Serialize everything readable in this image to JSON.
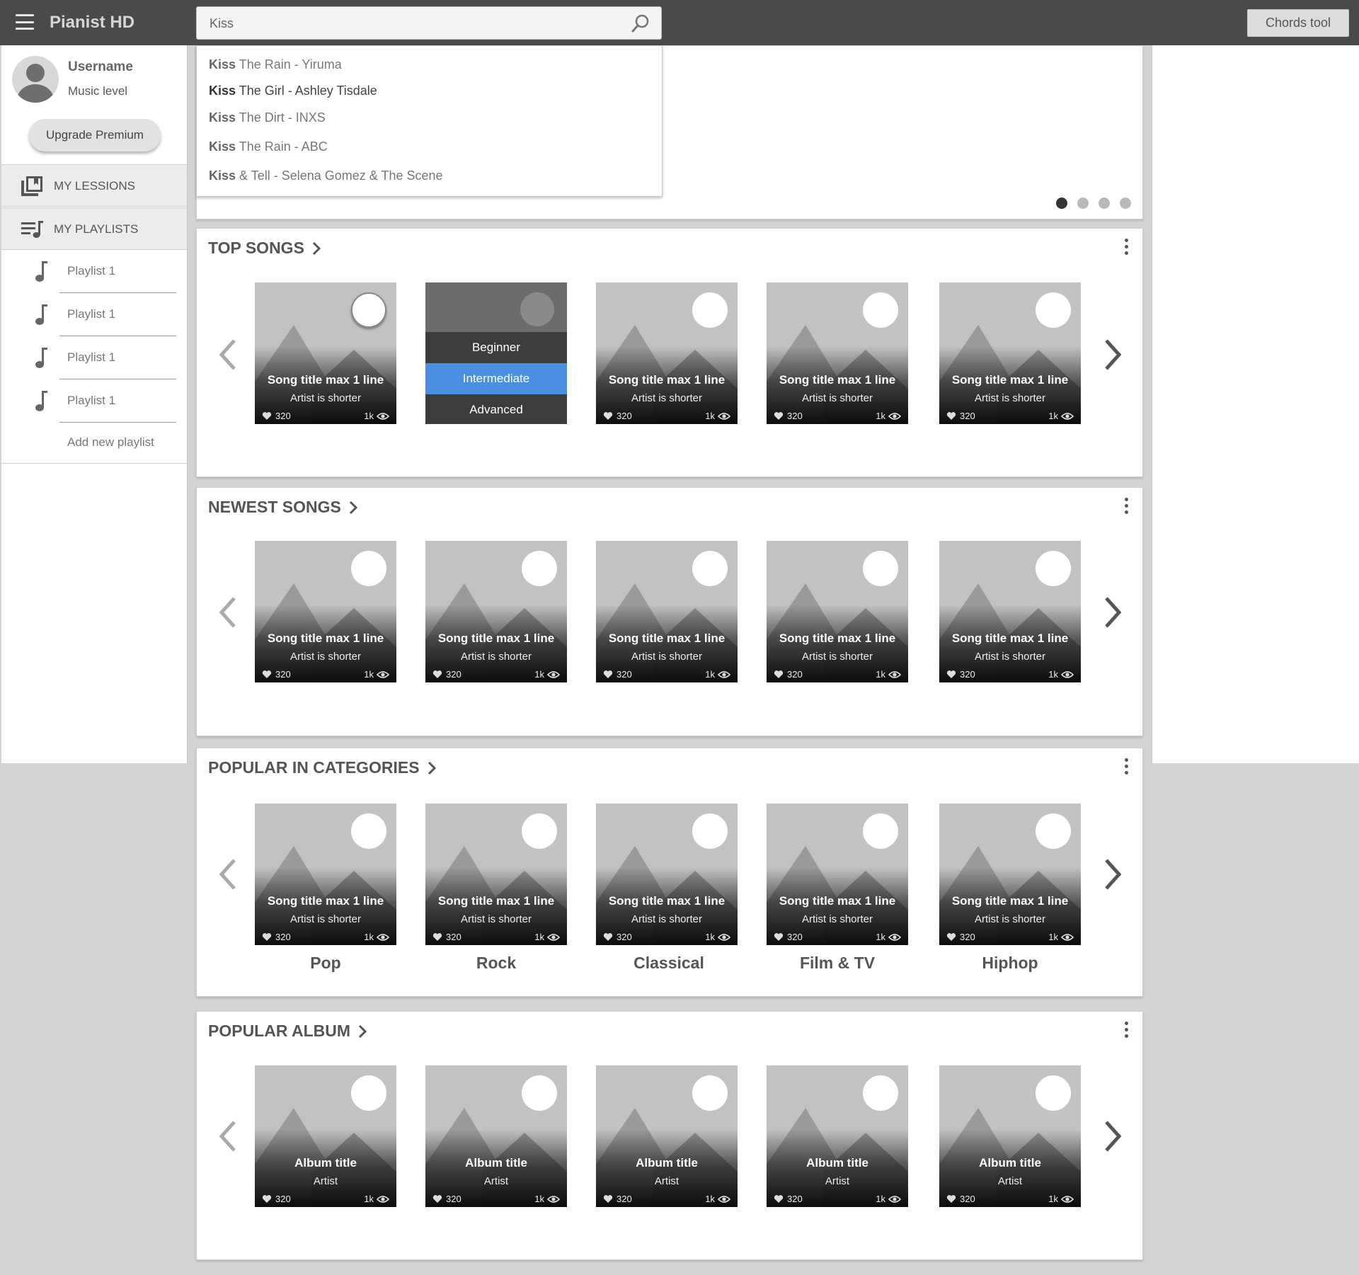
{
  "app": {
    "title": "Pianist HD"
  },
  "search": {
    "value": "Kiss",
    "placeholder": ""
  },
  "toolbar": {
    "chords_label": "Chords tool"
  },
  "suggestions": [
    {
      "query": "Kiss",
      "rest": " The Rain -  Yiruma"
    },
    {
      "query": "Kiss",
      "rest": " The Girl - Ashley Tisdale"
    },
    {
      "query": "Kiss",
      "rest": " The Dirt - INXS"
    },
    {
      "query": "Kiss",
      "rest": " The Rain -  ABC"
    },
    {
      "query": "Kiss",
      "rest": " & Tell -  Selena Gomez & The Scene"
    }
  ],
  "user": {
    "name": "Username",
    "level": "Music level",
    "upgrade_label": "Upgrade Premium"
  },
  "sidebar": {
    "lessons_label": "MY LESSIONS",
    "playlists_label": "MY PLAYLISTS",
    "playlists": [
      "Playlist 1",
      "Playlist 1",
      "Playlist 1",
      "Playlist 1"
    ],
    "add_playlist_label": "Add new playlist"
  },
  "sections": {
    "top_songs": {
      "title": "TOP SONGS",
      "song_title": "Song title max 1 line",
      "artist": "Artist is shorter",
      "likes": "320",
      "views": "1k",
      "levels": [
        "Beginner",
        "Intermediate",
        "Advanced"
      ],
      "selected_level": "Intermediate"
    },
    "newest_songs": {
      "title": "NEWEST SONGS",
      "song_title": "Song title max 1 line",
      "artist": "Artist is shorter",
      "likes": "320",
      "views": "1k"
    },
    "popular_categories": {
      "title": "POPULAR IN CATEGORIES",
      "song_title": "Song title max 1 line",
      "artist": "Artist is shorter",
      "likes": "320",
      "views": "1k",
      "categories": [
        "Pop",
        "Rock",
        "Classical",
        "Film & TV",
        "Hiphop"
      ]
    },
    "popular_album": {
      "title": "POPULAR ALBUM",
      "album_title": "Album title",
      "artist": "Artist",
      "likes": "320",
      "views": "1k"
    }
  },
  "carousel": {
    "total_slides": 4,
    "active_slide": 1
  },
  "colors": {
    "topbar": "#4a4a4a",
    "accent": "#4a90e2",
    "background": "#d4d4d4"
  }
}
